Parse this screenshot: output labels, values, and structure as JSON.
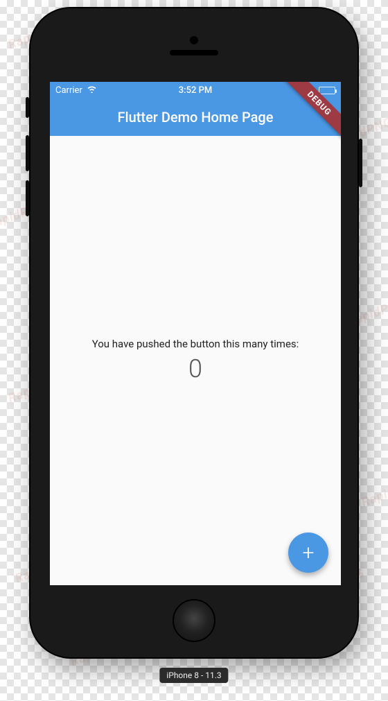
{
  "watermark_text": "RapidPNG",
  "status_bar": {
    "carrier": "Carrier",
    "time": "3:52 PM"
  },
  "app_bar": {
    "title": "Flutter Demo Home Page"
  },
  "body": {
    "push_label": "You have pushed the button this many times:",
    "counter": "0"
  },
  "fab": {
    "glyph": "+"
  },
  "debug_ribbon": "DEBUG",
  "simulator_label": "iPhone 8 - 11.3",
  "colors": {
    "primary": "#4a97e4",
    "ribbon": "#9e3a44"
  }
}
